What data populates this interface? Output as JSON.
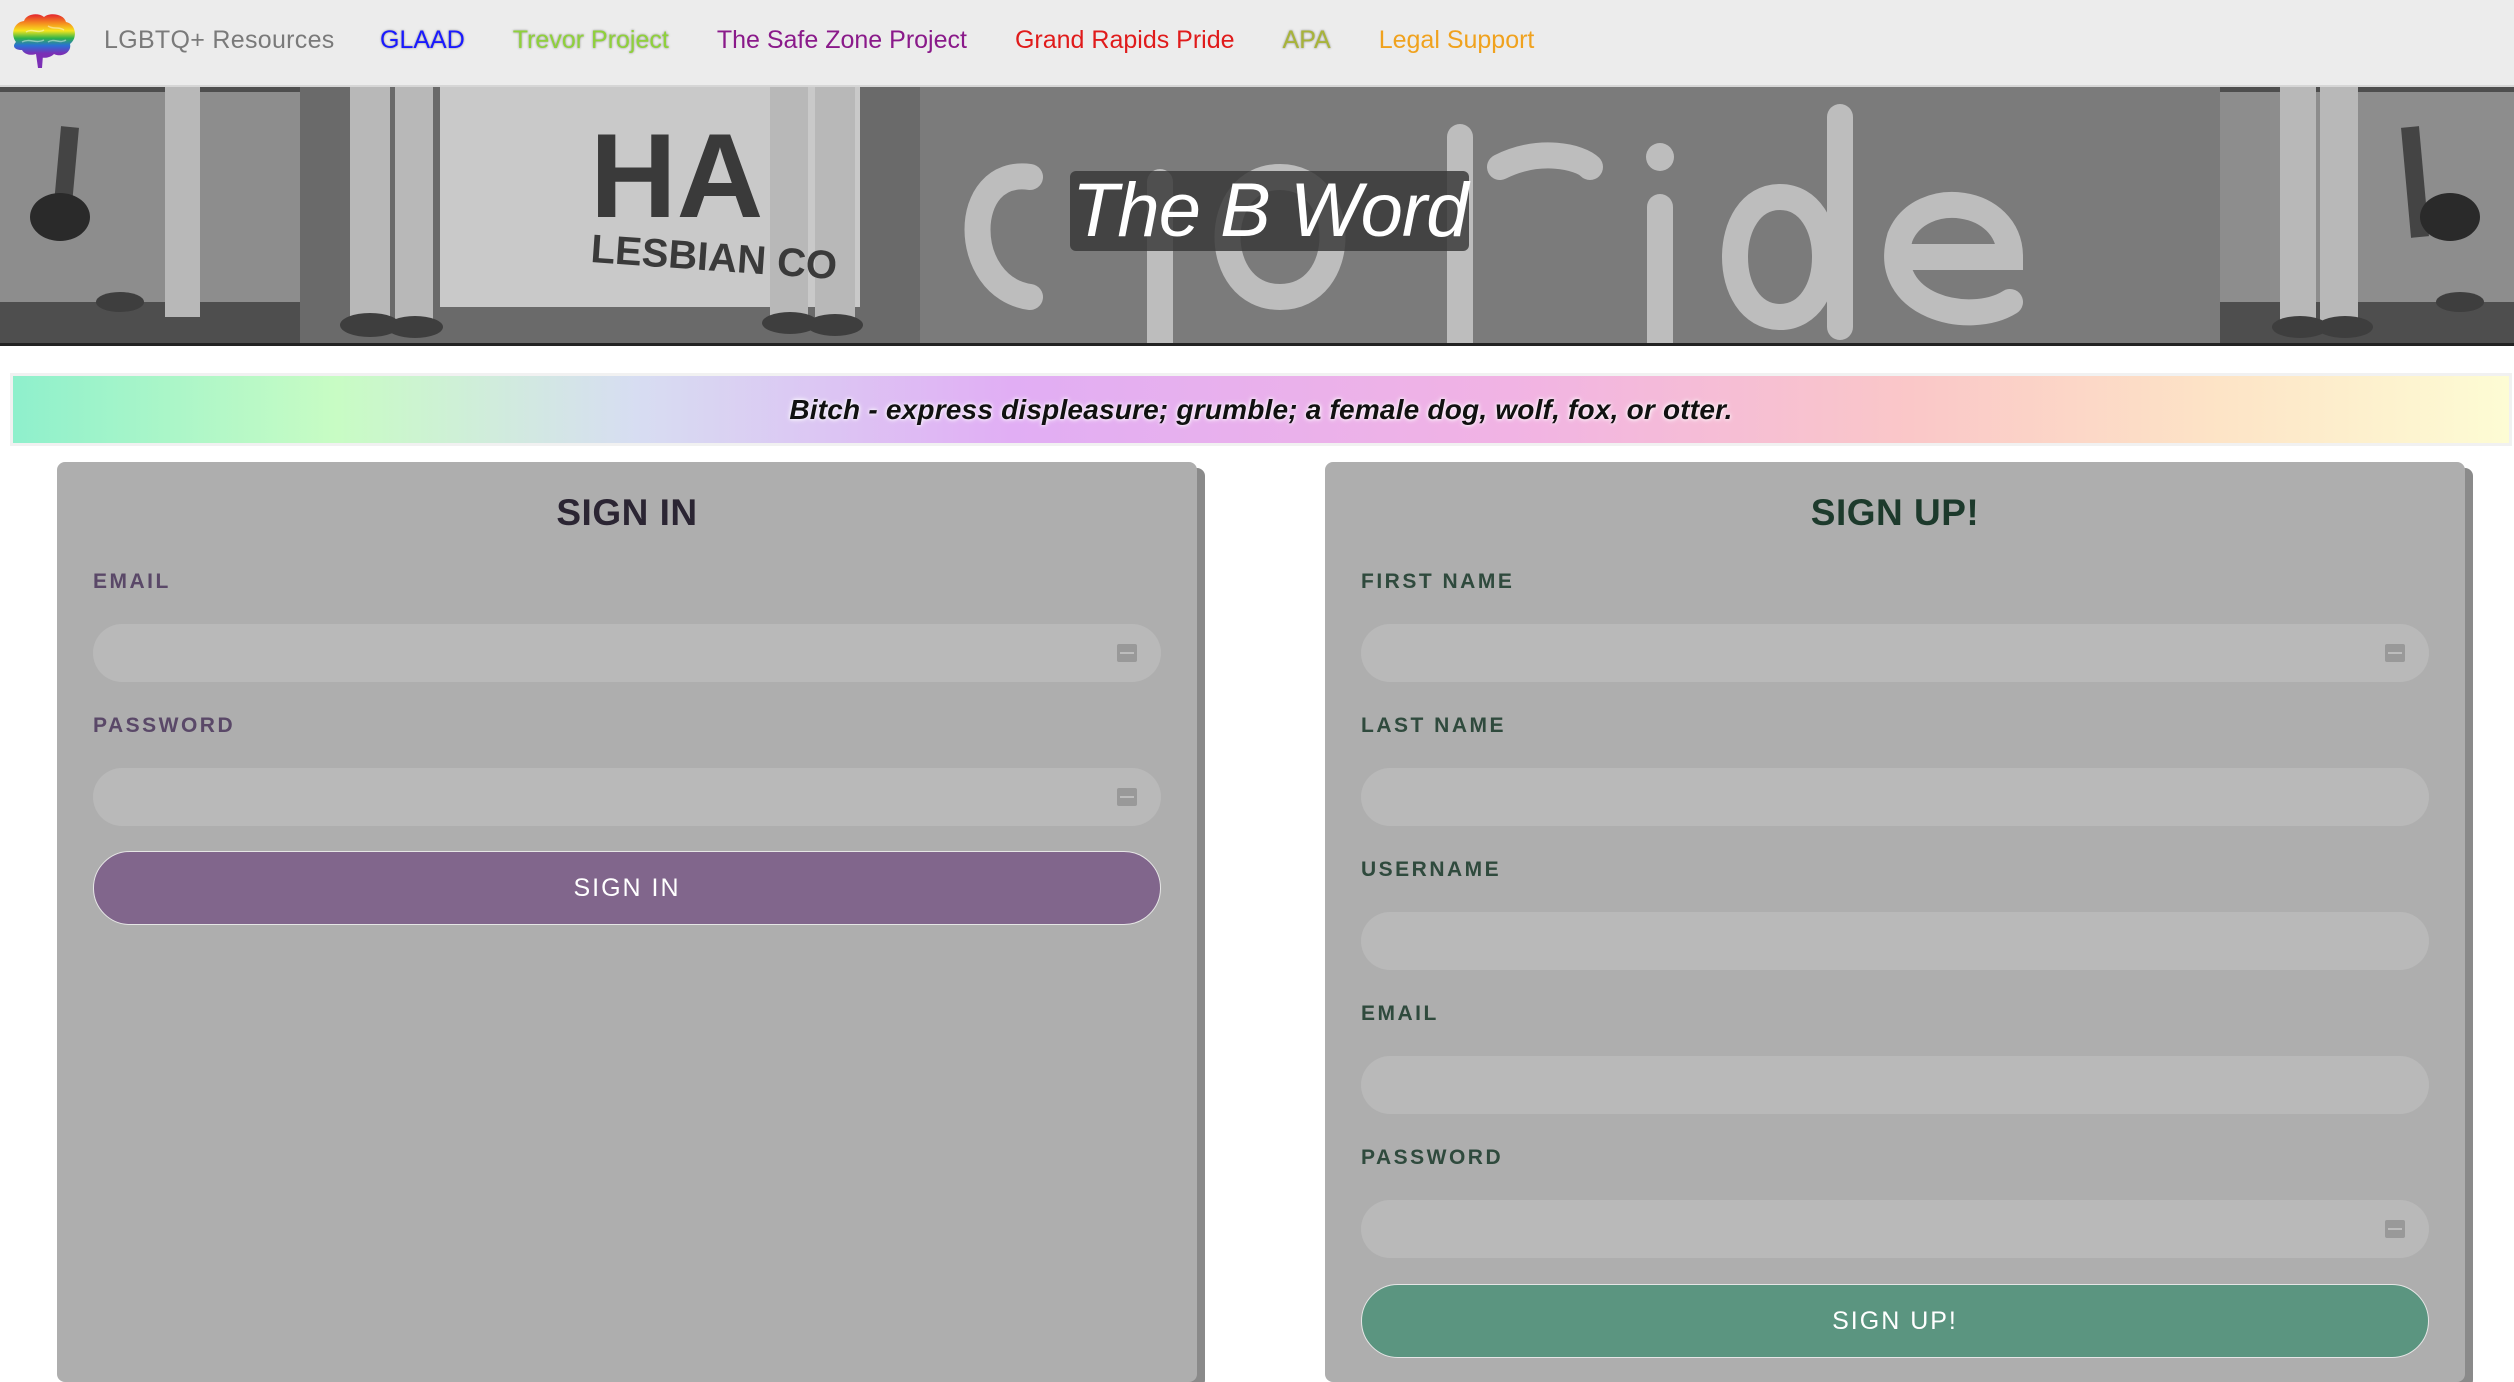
{
  "navbar": {
    "brand": "LGBTQ+ Resources",
    "links": [
      {
        "label": "GLAAD",
        "color": "#1a1aff"
      },
      {
        "label": "Trevor Project",
        "color": "#8fd13b"
      },
      {
        "label": "The Safe Zone Project",
        "color": "#8a1a8a"
      },
      {
        "label": "Grand Rapids Pride",
        "color": "#e01b1b"
      },
      {
        "label": "APA",
        "color": "#a8b43a"
      },
      {
        "label": "Legal Support",
        "color": "#f0a21e"
      }
    ],
    "logo_icon": "rainbow-brain-icon"
  },
  "hero": {
    "title": "The B Word"
  },
  "definition": {
    "text": "Bitch - express displeasure; grumble; a female dog, wolf, fox, or otter."
  },
  "sign_in": {
    "title": "SIGN IN",
    "email_label": "EMAIL",
    "email_value": "",
    "password_label": "PASSWORD",
    "password_value": "",
    "button_label": "SIGN IN",
    "button_color": "#81668c"
  },
  "sign_up": {
    "title": "SIGN UP!",
    "first_name_label": "FIRST NAME",
    "last_name_label": "LAST NAME",
    "username_label": "USERNAME",
    "email_label": "EMAIL",
    "password_label": "PASSWORD",
    "button_label": "SIGN UP!",
    "button_color": "#5b9580"
  },
  "colors": {
    "panel_bg": "#aeaeae",
    "navbar_bg": "#ececec"
  }
}
